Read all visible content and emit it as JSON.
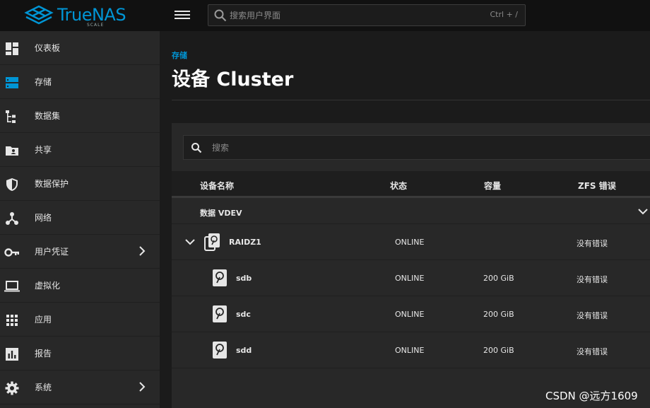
{
  "header": {
    "logo_text": "TrueNAS",
    "logo_sub": "SCALE",
    "search_placeholder": "搜索用户界面",
    "search_shortcut": "Ctrl + /"
  },
  "sidebar": {
    "items": [
      {
        "label": "仪表板",
        "icon": "dashboard-icon"
      },
      {
        "label": "存储",
        "icon": "storage-icon",
        "active": true
      },
      {
        "label": "数据集",
        "icon": "dataset-icon"
      },
      {
        "label": "共享",
        "icon": "share-folder-icon"
      },
      {
        "label": "数据保护",
        "icon": "shield-icon"
      },
      {
        "label": "网络",
        "icon": "network-icon"
      },
      {
        "label": "用户凭证",
        "icon": "key-icon",
        "chevron": true
      },
      {
        "label": "虚拟化",
        "icon": "laptop-icon"
      },
      {
        "label": "应用",
        "icon": "apps-grid-icon"
      },
      {
        "label": "报告",
        "icon": "chart-icon"
      },
      {
        "label": "系统",
        "icon": "gear-icon",
        "chevron": true
      }
    ]
  },
  "main": {
    "breadcrumb": "存储",
    "title": "设备 Cluster",
    "filter_placeholder": "搜索",
    "columns": [
      "设备名称",
      "状态",
      "容量",
      "ZFS 错误"
    ],
    "group_label": "数据 VDEV",
    "rows": [
      {
        "name": "RAIDZ1",
        "status": "ONLINE",
        "capacity": "",
        "errors": "没有错误",
        "type": "vdev"
      },
      {
        "name": "sdb",
        "status": "ONLINE",
        "capacity": "200 GiB",
        "errors": "没有错误",
        "type": "disk"
      },
      {
        "name": "sdc",
        "status": "ONLINE",
        "capacity": "200 GiB",
        "errors": "没有错误",
        "type": "disk"
      },
      {
        "name": "sdd",
        "status": "ONLINE",
        "capacity": "200 GiB",
        "errors": "没有错误",
        "type": "disk"
      }
    ]
  },
  "watermark": "CSDN @远方1609",
  "colors": {
    "accent": "#0095d5",
    "topbar": "#111111",
    "sidebar": "#282828",
    "background": "#1b1b1b"
  }
}
